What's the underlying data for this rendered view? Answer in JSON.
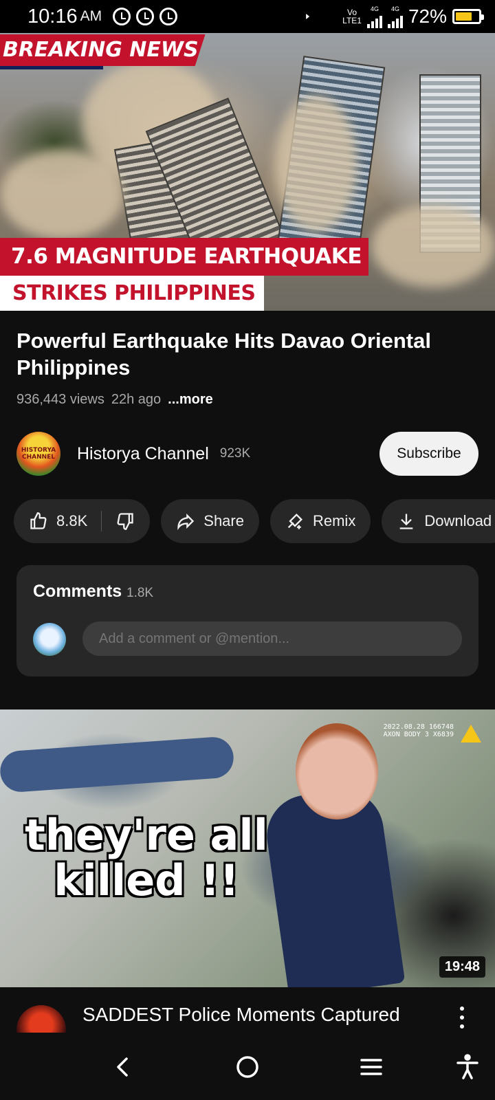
{
  "status_bar": {
    "time": "10:16",
    "ampm": "AM",
    "network_top": "Vo",
    "network_bottom": "LTE1",
    "network_4g_a": "4G",
    "network_4g_b": "4G",
    "battery_percent": "72%",
    "battery_level": 0.72,
    "battery_color": "#f5c518"
  },
  "video": {
    "thumbnail_banner": "BREAKING NEWS",
    "thumbnail_line1": "7.6 MAGNITUDE EARTHQUAKE",
    "thumbnail_line2": "STRIKES PHILIPPINES",
    "title": "Powerful Earthquake Hits Davao Oriental Philippines",
    "views": "936,443 views",
    "age": "22h ago",
    "more": "...more"
  },
  "channel": {
    "avatar_text": "HISTORYA CHANNEL",
    "name": "Historya Channel",
    "subscribers": "923K",
    "subscribe_label": "Subscribe"
  },
  "actions": {
    "likes": "8.8K",
    "share": "Share",
    "remix": "Remix",
    "download": "Download"
  },
  "comments": {
    "title": "Comments",
    "count": "1.8K",
    "placeholder": "Add a comment or @mention..."
  },
  "next_video": {
    "overlay_text": "they're all killed !!",
    "cam_stamp": "2022.08.28 166748 AXON BODY 3 X6839",
    "duration": "19:48",
    "title": "SADDEST Police Moments Captured"
  },
  "colors": {
    "background": "#0f0f0f",
    "surface": "#272727",
    "breaking_red": "#c3122b"
  }
}
